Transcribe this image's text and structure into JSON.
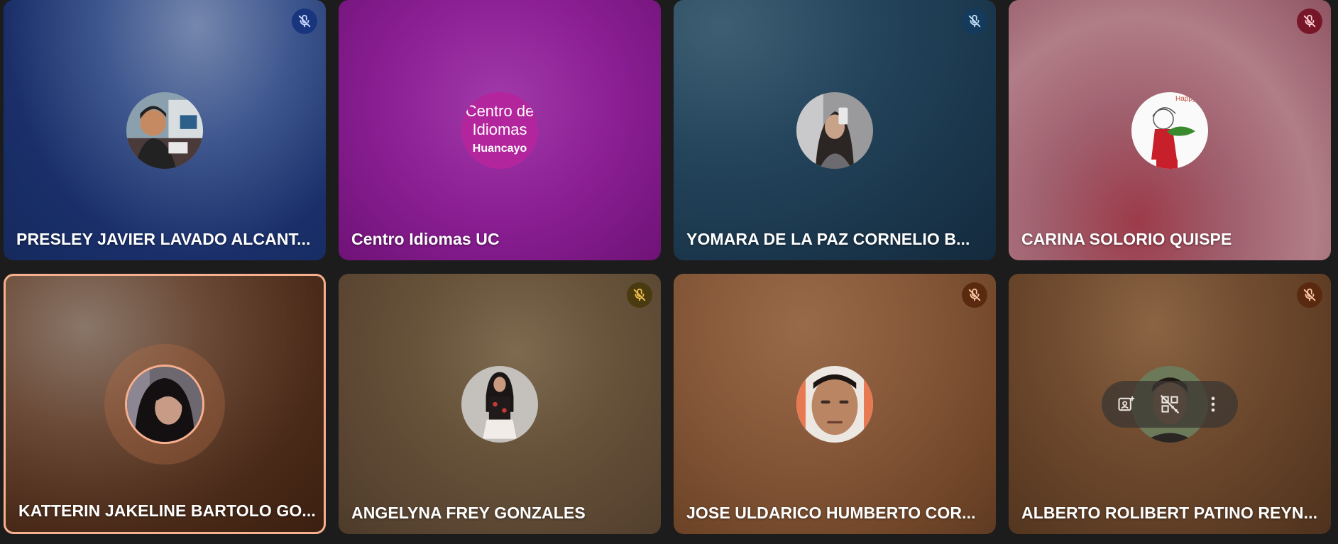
{
  "participants": [
    {
      "name": "PRESLEY JAVIER LAVADO ALCANT...",
      "muted": true,
      "mic_color": "#18357e"
    },
    {
      "name": "Centro Idiomas UC",
      "muted": false,
      "logo": {
        "line1": "Centro de",
        "line2": "Idiomas",
        "line3": "Huancayo"
      }
    },
    {
      "name": "YOMARA DE LA PAZ CORNELIO B...",
      "muted": true,
      "mic_color": "#143a5c"
    },
    {
      "name": "CARINA SOLORIO QUISPE",
      "muted": true,
      "mic_color": "#761628",
      "avatar_text": "Happy B"
    },
    {
      "name": "KATTERIN JAKELINE BARTOLO GO...",
      "muted": false,
      "speaking": true,
      "highlight_color": "#f7b08f"
    },
    {
      "name": "ANGELYNA FREY GONZALES",
      "muted": true,
      "mic_color": "#4a3a10"
    },
    {
      "name": "JOSE ULDARICO HUMBERTO COR...",
      "muted": true,
      "mic_color": "#5a2a10"
    },
    {
      "name": "ALBERTO ROLIBERT PATINO REYN...",
      "muted": true,
      "mic_color": "#5a2a10",
      "hover_controls": [
        "add-to-frame-icon",
        "remove-qr-icon",
        "more-options-icon"
      ]
    }
  ]
}
